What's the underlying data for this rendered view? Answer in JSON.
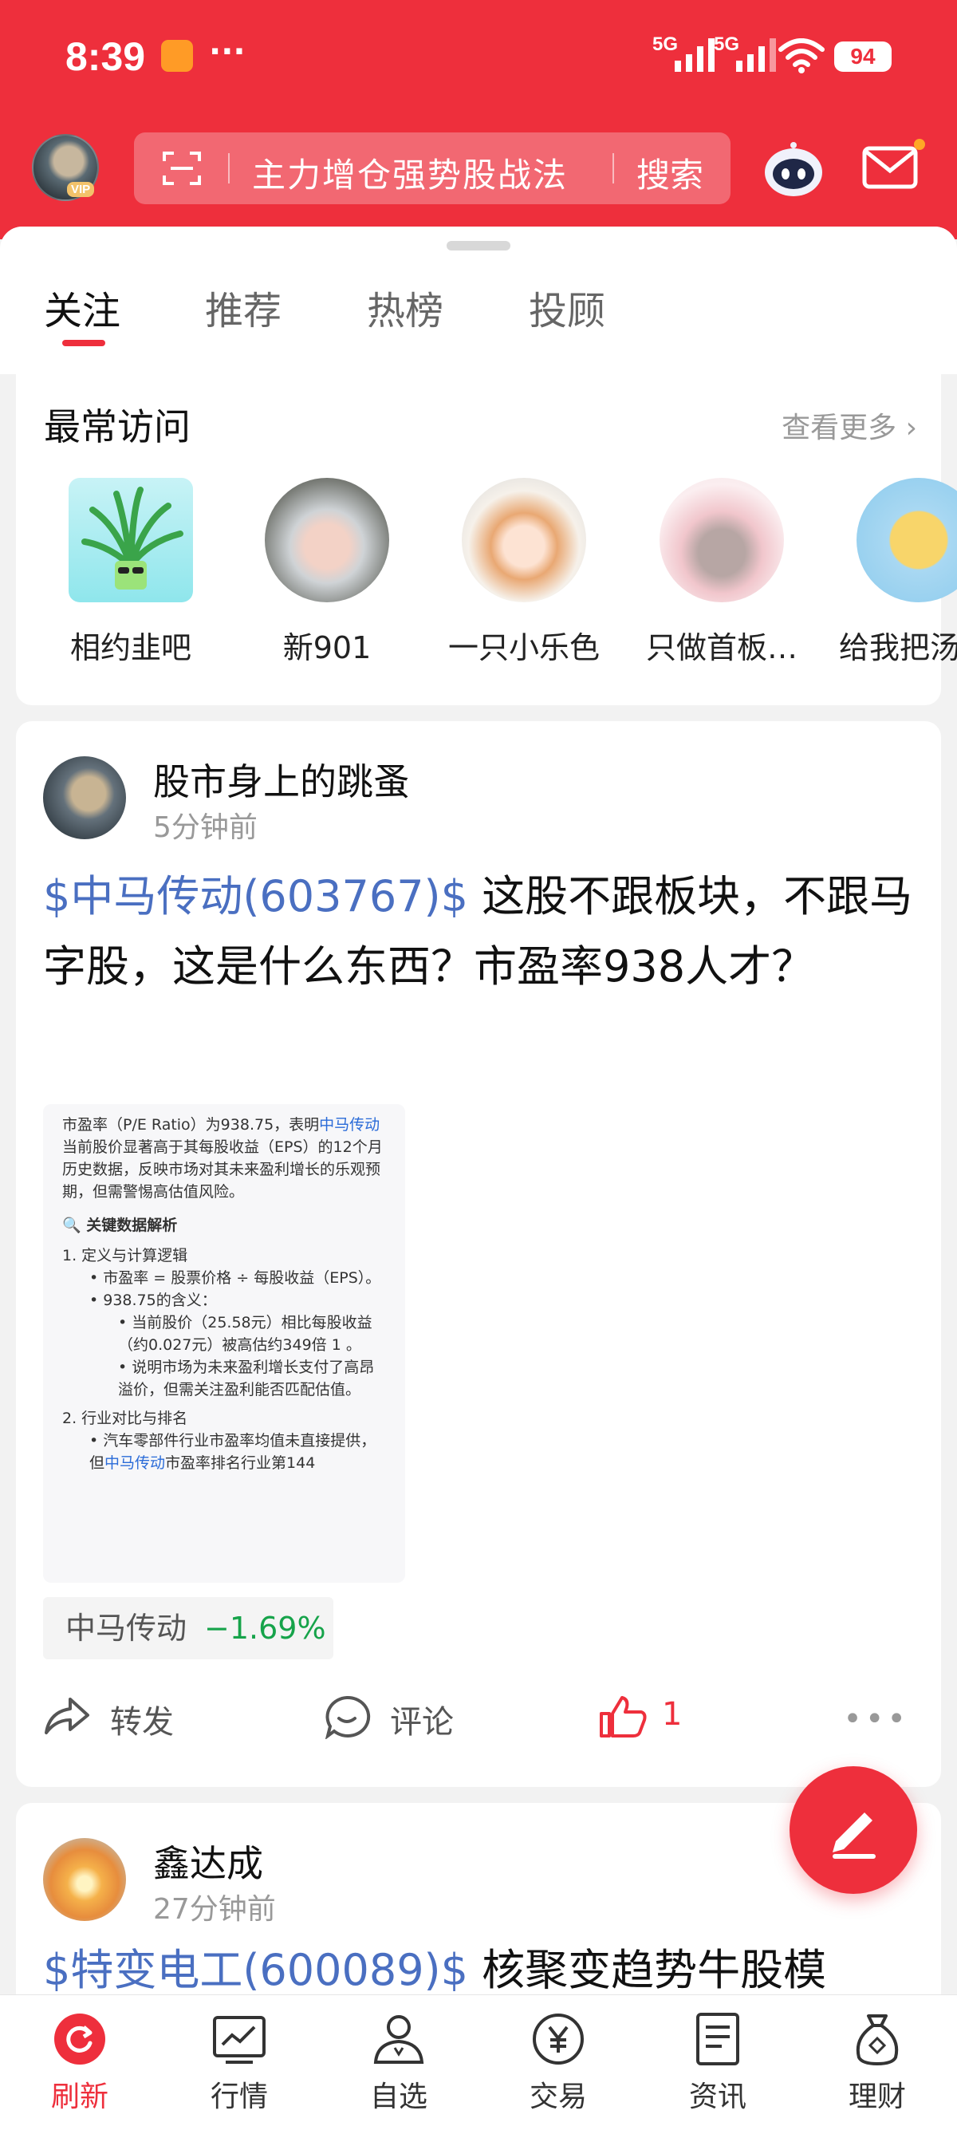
{
  "status_bar": {
    "time": "8:39",
    "dots": "···",
    "signal1": "5G",
    "signal2": "5G",
    "battery": "94"
  },
  "header": {
    "search_hint": "主力增仓强势股战法",
    "search_button": "搜索",
    "vip_badge": "VIP"
  },
  "tabs": [
    {
      "label": "关注",
      "active": true
    },
    {
      "label": "推荐",
      "active": false
    },
    {
      "label": "热榜",
      "active": false
    },
    {
      "label": "投顾",
      "active": false
    }
  ],
  "frequent": {
    "title": "最常访问",
    "more": "查看更多",
    "items": [
      {
        "name": "相约韭吧"
      },
      {
        "name": "新901"
      },
      {
        "name": "一只小乐色"
      },
      {
        "name": "只做首板…"
      },
      {
        "name": "给我把汤"
      }
    ]
  },
  "post1": {
    "author": "股市身上的跳蚤",
    "time": "5分钟前",
    "stock_tag": "$中马传动(603767)$",
    "text": " 这股不跟板块，不跟马字股，这是什么东西？市盈率938人才？",
    "screenshot_lines": {
      "p1a": "市盈率（P/E Ratio）为938.75，表明",
      "p1b": "中马传动",
      "p1c": "当前股价显著高于其每股收益（EPS）的12个月历史数据，反映市场对其未来盈利增长的乐观预期，但需警惕高估值风险。",
      "h1": "🔍 关键数据解析",
      "h2": "1. 定义与计算逻辑",
      "l1": "• 市盈率 = 股票价格 ÷ 每股收益（EPS）。",
      "l2": "• 938.75的含义：",
      "l3": "• 当前股价（25.58元）相比每股收益（约0.027元）被高估约349倍 1 。",
      "l4": "• 说明市场为未来盈利增长支付了高昂溢价，但需关注盈利能否匹配估值。",
      "h3": "2. 行业对比与排名",
      "l5a": "• 汽车零部件行业市盈率均值未直接提供，但",
      "l5b": "中马传动",
      "l5c": "市盈率排名行业第144"
    },
    "chip_name": "中马传动",
    "chip_change": "−1.69%",
    "actions": {
      "share": "转发",
      "comment": "评论",
      "like": "1"
    }
  },
  "post2": {
    "author": "鑫达成",
    "time": "27分钟前",
    "stock_tag": "$特变电工(600089)$",
    "text": " 核聚变趋势牛股模"
  },
  "bottom_nav": [
    {
      "label": "刷新",
      "icon": "refresh-icon",
      "active": true
    },
    {
      "label": "行情",
      "icon": "chart-icon",
      "active": false
    },
    {
      "label": "自选",
      "icon": "person-icon",
      "active": false
    },
    {
      "label": "交易",
      "icon": "yen-icon",
      "active": false
    },
    {
      "label": "资讯",
      "icon": "document-icon",
      "active": false
    },
    {
      "label": "理财",
      "icon": "moneybag-icon",
      "active": false
    }
  ],
  "colors": {
    "brand": "#ee2f3c",
    "link": "#4a6fc1",
    "down": "#16a34a"
  }
}
